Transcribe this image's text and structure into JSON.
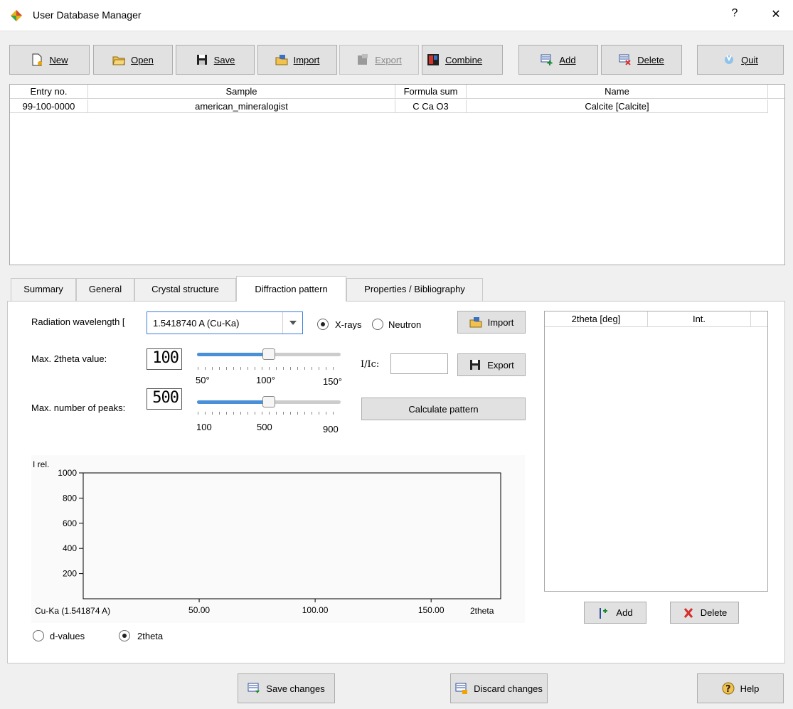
{
  "window": {
    "title": "User Database Manager",
    "help_glyph": "?",
    "close_glyph": "✕"
  },
  "toolbar": {
    "new": "New",
    "open": "Open",
    "save": "Save",
    "import": "Import",
    "export": "Export",
    "combine": "Combine",
    "add": "Add",
    "delete": "Delete",
    "quit": "Quit"
  },
  "entries": {
    "columns": [
      "Entry no.",
      "Sample",
      "Formula sum",
      "Name"
    ],
    "rows": [
      [
        "99-100-0000",
        "american_mineralogist",
        "C Ca O3",
        "Calcite [Calcite]"
      ]
    ]
  },
  "tabs": [
    "Summary",
    "General",
    "Crystal structure",
    "Diffraction pattern",
    "Properties / Bibliography"
  ],
  "active_tab": "Diffraction pattern",
  "diffraction": {
    "wavelength_label": "Radiation wavelength [",
    "wavelength_value": "1.5418740 A (Cu-Ka)",
    "radio_xrays": "X-rays",
    "radio_neutron": "Neutron",
    "radiation_selected": "X-rays",
    "import_btn": "Import",
    "export_btn": "Export",
    "ilc_label": "I/Ic:",
    "ilc_value": "",
    "max2theta_label": "Max. 2theta value:",
    "max2theta_display": "100",
    "max2theta_level": 0.5,
    "slider1_ticks": [
      "50°",
      "100°",
      "150°"
    ],
    "maxpeaks_label": "Max. number of peaks:",
    "maxpeaks_display": "500",
    "maxpeaks_level": 0.5,
    "slider2_ticks": [
      "100",
      "500",
      "900"
    ],
    "calculate_btn": "Calculate pattern",
    "axis_selected": "2theta",
    "radio_dvalues": "d-values",
    "radio_2theta": "2theta"
  },
  "peaks_table": {
    "columns": [
      "2theta [deg]",
      "Int."
    ],
    "add": "Add",
    "delete": "Delete"
  },
  "footer": {
    "save_changes": "Save changes",
    "discard_changes": "Discard changes",
    "help": "Help"
  },
  "chart_data": {
    "type": "line",
    "ylabel": "I rel.",
    "xlabel": "2theta",
    "subtitle": "Cu-Ka (1.541874 A)",
    "y_ticks": [
      200,
      400,
      600,
      800,
      1000
    ],
    "x_ticks": [
      "50.00",
      "100.00",
      "150.00"
    ],
    "x_tick_values": [
      50,
      100,
      150
    ],
    "xlim": [
      0,
      180
    ],
    "ylim": [
      0,
      1000
    ],
    "series": []
  },
  "colors": {
    "accent": "#4a90d9",
    "window_bg": "#f0f0f0",
    "button_bg": "#e1e1e1"
  }
}
